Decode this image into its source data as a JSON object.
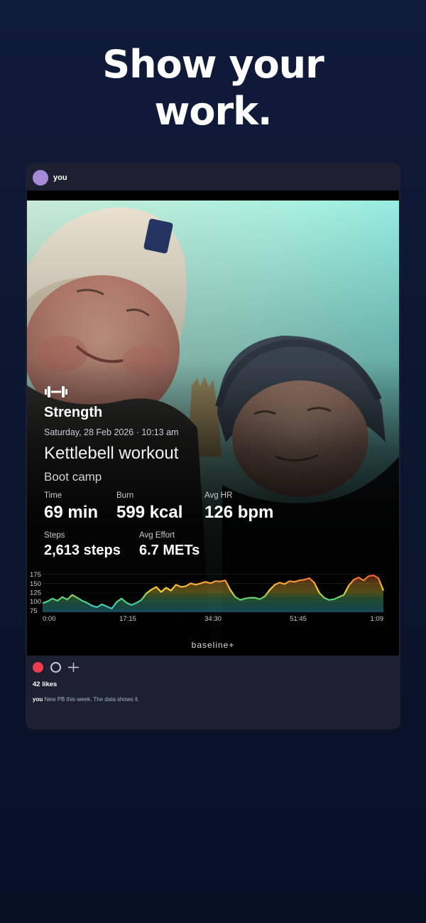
{
  "headline": {
    "line1": "Show your",
    "line2": "work."
  },
  "post": {
    "username": "you",
    "likes": "42 likes",
    "caption_user": "you",
    "caption_text": "New PB this week. The data shows it."
  },
  "workout": {
    "type": "Strength",
    "datetime": "Saturday, 28 Feb 2026 · 10:13 am",
    "name": "Kettlebell workout",
    "subtitle": "Boot camp",
    "metrics": {
      "time": {
        "label": "Time",
        "value": "69 min"
      },
      "burn": {
        "label": "Burn",
        "value": "599 kcal"
      },
      "avg_hr": {
        "label": "Avg HR",
        "value": "126 bpm"
      },
      "steps": {
        "label": "Steps",
        "value": "2,613 steps"
      },
      "avg_effort": {
        "label": "Avg Effort",
        "value": "6.7 METs"
      }
    },
    "brand": "baseline+"
  },
  "chart_data": {
    "type": "area",
    "title": "",
    "xlabel": "",
    "ylabel": "",
    "x_ticks": [
      "0:00",
      "17:15",
      "34:30",
      "51:45",
      "1:09"
    ],
    "y_ticks": [
      175,
      150,
      125,
      100,
      75
    ],
    "ylim": [
      70,
      180
    ],
    "xlim": [
      0,
      69
    ],
    "series": [
      {
        "x": [
          0,
          1,
          2,
          3,
          4,
          5,
          6,
          7,
          8,
          9,
          10,
          11,
          12,
          13,
          14,
          15,
          16,
          17,
          18,
          19,
          20,
          21,
          22,
          23,
          24,
          25,
          26,
          27,
          28,
          29,
          30,
          31,
          32,
          33,
          34,
          35,
          36,
          37,
          38,
          39,
          40,
          41,
          42,
          43,
          44,
          45,
          46,
          47,
          48,
          49,
          50,
          51,
          52,
          53,
          54,
          55,
          56,
          57,
          58,
          59,
          60,
          61,
          62,
          63,
          64,
          65,
          66,
          67,
          68,
          69
        ],
        "y": [
          95,
          100,
          108,
          102,
          112,
          105,
          118,
          110,
          102,
          96,
          88,
          84,
          92,
          86,
          80,
          98,
          108,
          96,
          90,
          96,
          104,
          122,
          132,
          140,
          126,
          138,
          130,
          146,
          140,
          142,
          150,
          146,
          150,
          154,
          150,
          156,
          155,
          158,
          132,
          112,
          104,
          108,
          110,
          110,
          106,
          114,
          132,
          146,
          152,
          148,
          156,
          154,
          158,
          160,
          164,
          152,
          124,
          110,
          104,
          106,
          112,
          118,
          144,
          160,
          166,
          158,
          170,
          172,
          164,
          130
        ]
      }
    ],
    "grid": true,
    "colors": {
      "low": "#39c3f0",
      "mid_low": "#57d07c",
      "mid": "#f5d23a",
      "mid_high": "#f5a23a",
      "high": "#ef3a3a"
    }
  },
  "colors": {
    "background_top": "#0f1b3a",
    "background_bottom": "#081024",
    "card": "#1c2030",
    "avatar": "#a58ad6",
    "like": "#ee3d4e"
  },
  "icons": {
    "avatar": "avatar-circle",
    "workout_type": "dumbbell-icon",
    "like": "heart-dot-icon",
    "comment": "comment-ring-icon",
    "share": "plus-share-icon"
  }
}
